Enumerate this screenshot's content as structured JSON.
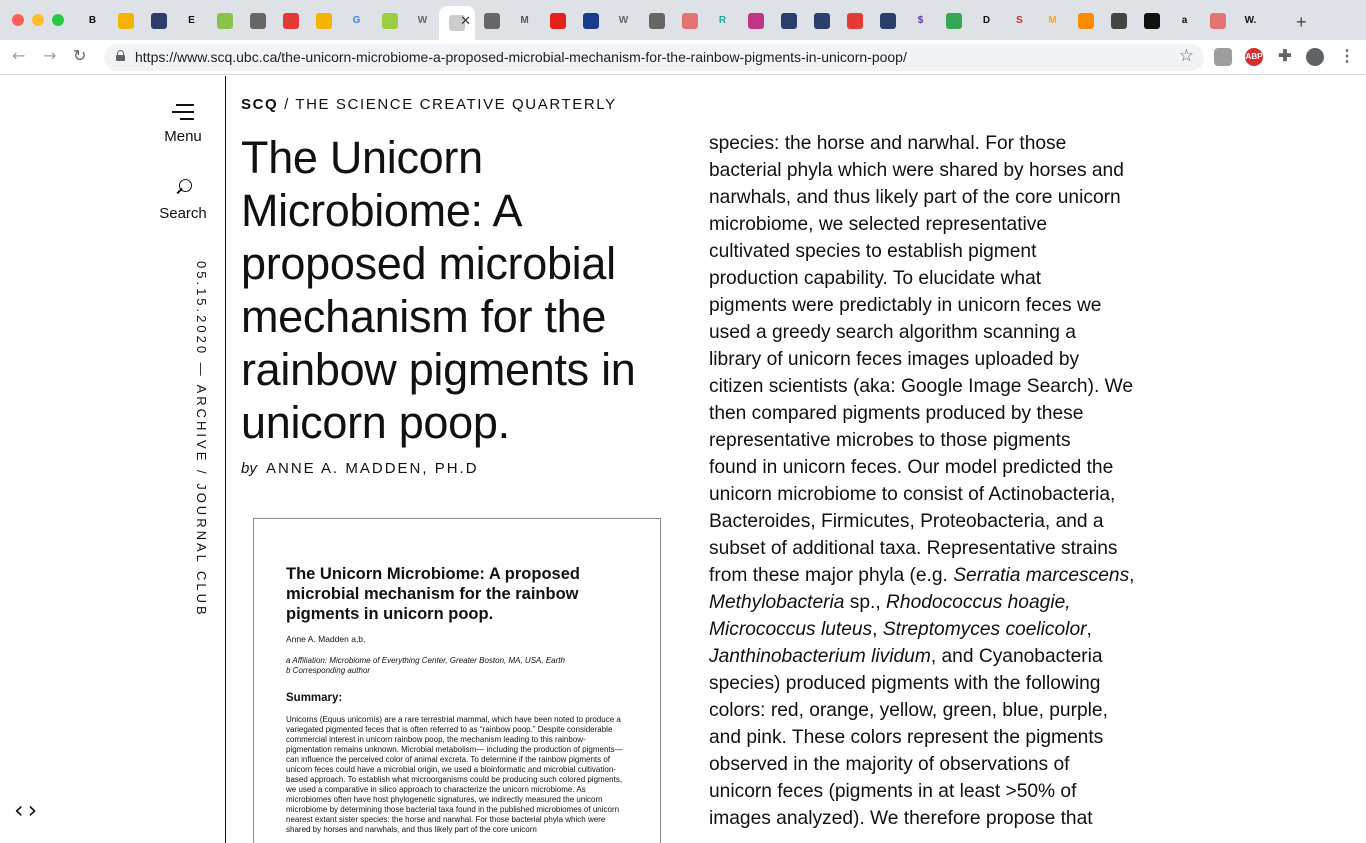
{
  "browser": {
    "url": "https://www.scq.ubc.ca/the-unicorn-microbiome-a-proposed-microbial-mechanism-for-the-rainbow-pigments-in-unicorn-poop/",
    "tabs": [
      {
        "icon": "b-icon",
        "letter": "B",
        "color": "#111111"
      },
      {
        "icon": "slides-icon",
        "letter": "",
        "color": "#f4b400"
      },
      {
        "icon": "aeroplane-icon",
        "letter": "",
        "color": "#2c3e6b"
      },
      {
        "icon": "e-icon",
        "letter": "E",
        "color": "#111111"
      },
      {
        "icon": "sheets-icon",
        "letter": "",
        "color": "#8bc34a"
      },
      {
        "icon": "globe-icon",
        "letter": "",
        "color": "#666666"
      },
      {
        "icon": "pocket-icon",
        "letter": "",
        "color": "#e53935"
      },
      {
        "icon": "cc-icon",
        "letter": "",
        "color": "#f5b400"
      },
      {
        "icon": "google-icon",
        "letter": "G",
        "color": "#4285f4"
      },
      {
        "icon": "leaf-icon",
        "letter": "",
        "color": "#9ccc3f"
      },
      {
        "icon": "wikipedia-icon",
        "letter": "W",
        "color": "#666666"
      },
      {
        "icon": "scq-icon",
        "letter": "",
        "color": "#cccccc"
      },
      {
        "icon": "globe-icon",
        "letter": "",
        "color": "#666666"
      },
      {
        "icon": "medium-icon",
        "letter": "M",
        "color": "#555555"
      },
      {
        "icon": "youtube-icon",
        "letter": "",
        "color": "#e62117"
      },
      {
        "icon": "circle-icon",
        "letter": "",
        "color": "#1a3a8f"
      },
      {
        "icon": "wikipedia-icon",
        "letter": "W",
        "color": "#666666"
      },
      {
        "icon": "globe-icon",
        "letter": "",
        "color": "#666666"
      },
      {
        "icon": "grid-icon",
        "letter": "",
        "color": "#e57373"
      },
      {
        "icon": "rg-icon",
        "letter": "R",
        "color": "#26a69a"
      },
      {
        "icon": "instagram-icon",
        "letter": "",
        "color": "#c13584"
      },
      {
        "icon": "aeroplane-icon",
        "letter": "",
        "color": "#2c3e6b"
      },
      {
        "icon": "aeroplane-icon",
        "letter": "",
        "color": "#2c3e6b"
      },
      {
        "icon": "ring-icon",
        "letter": "",
        "color": "#e53935"
      },
      {
        "icon": "aeroplane-icon",
        "letter": "",
        "color": "#2c3e6b"
      },
      {
        "icon": "dollar-icon",
        "letter": "$",
        "color": "#5e35b1"
      },
      {
        "icon": "drive-icon",
        "letter": "",
        "color": "#34a853"
      },
      {
        "icon": "d-icon",
        "letter": "D",
        "color": "#111111"
      },
      {
        "icon": "s-icon",
        "letter": "S",
        "color": "#d32f2f"
      },
      {
        "icon": "m-icon",
        "letter": "M",
        "color": "#f9a825"
      },
      {
        "icon": "blocks-icon",
        "letter": "",
        "color": "#fb8c00"
      },
      {
        "icon": "pin-icon",
        "letter": "",
        "color": "#444444"
      },
      {
        "icon": "black-circle-icon",
        "letter": "",
        "color": "#111111"
      },
      {
        "icon": "amazon-icon",
        "letter": "a",
        "color": "#111111"
      },
      {
        "icon": "target-icon",
        "letter": "",
        "color": "#e57373"
      },
      {
        "icon": "w-dot-icon",
        "letter": "W.",
        "color": "#111111"
      }
    ],
    "active_tab_index": 11,
    "new_tab_symbol": "+"
  },
  "site": {
    "menu_label": "Menu",
    "search_label": "Search",
    "vertical_meta": "05.15.2020 — ARCHIVE / JOURNAL CLUB",
    "nav_arrows": "‹›",
    "brand": "SCQ",
    "breadcrumb_rest": "/ THE SCIENCE CREATIVE QUARTERLY"
  },
  "article": {
    "title": "The Unicorn Microbiome: A proposed microbial mechanism for the rainbow pigments in unicorn poop.",
    "by": "by",
    "author": "ANNE A. MADDEN, PH.D",
    "thumbnail": {
      "title": "The Unicorn Microbiome: A proposed microbial mechanism for the rainbow pigments in unicorn poop.",
      "author": "Anne A. Madden a,b,",
      "affiliation_a": "a Affiliation: Microbiome of Everything Center, Greater Boston, MA, USA, Earth",
      "affiliation_b": "b Corresponding author",
      "summary_heading": "Summary:",
      "summary_text": "Unicorns (Equus unicornis) are a rare terrestrial mammal, which have been noted to produce a variegated pigmented feces that is often referred to as “rainbow poop.” Despite considerable commercial interest in unicorn rainbow poop, the mechanism leading to this rainbow-pigmentation remains unknown. Microbial metabolism— including the production of pigments— can influence the perceived color of animal excreta. To determine if the rainbow pigments of unicorn feces could have a microbial origin, we used a bioinformatic and microbial cultivation-based approach. To establish what microorganisms could be producing such colored pigments, we used a comparative in silico approach to characterize the unicorn microbiome. As microbiomes often have host phylogenetic signatures, we indirectly measured the unicorn microbiome by determining those bacterial taxa found in the published microbiomes of unicorn nearest extant sister species: the horse and narwhal. For those bacterial phyla which were shared by horses and narwhals, and thus likely part of the core unicorn"
    },
    "body_lines": [
      "species: the horse and narwhal. For those",
      "bacterial phyla which were shared by horses and",
      "narwhals, and thus likely part of the core unicorn",
      "microbiome, we selected representative",
      "cultivated species to establish pigment",
      "production capability. To elucidate what",
      "pigments were predictably in unicorn feces we",
      "used a greedy search algorithm scanning a",
      "library of unicorn feces images uploaded by",
      "citizen scientists (aka: Google Image Search). We",
      "then compared pigments produced by these",
      "representative microbes to those pigments",
      "found in unicorn feces. Our model predicted the",
      "unicorn microbiome to consist of Actinobacteria,",
      "Bacteroides, Firmicutes, Proteobacteria, and a",
      "subset of additional taxa. Representative strains",
      "from these major phyla (e.g. |Serratia marcescens|,",
      "|Methylobacteria| sp., |Rhodococcus hoagie,|",
      "|Micrococcus luteus|, |Streptomyces coelicolor|,",
      "|Janthinobacterium lividum|, and Cyanobacteria",
      "species) produced pigments with the following",
      "colors: red, orange, yellow, green, blue, purple,",
      "and pink. These colors represent the pigments",
      "observed in the majority of observations of",
      "unicorn feces (pigments in at least >50% of",
      "images analyzed). We therefore propose that"
    ]
  }
}
